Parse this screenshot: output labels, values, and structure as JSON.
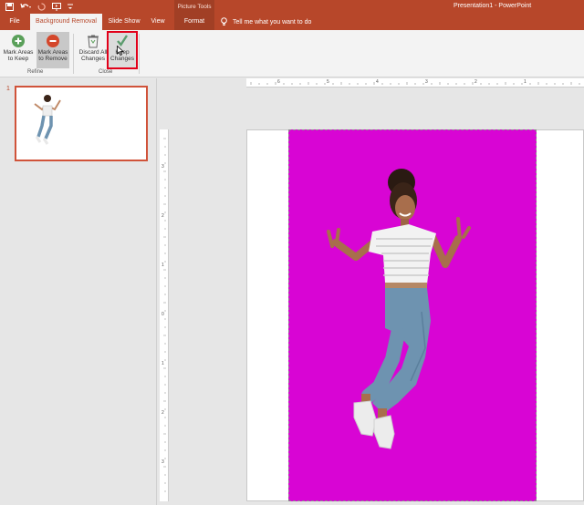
{
  "titlebar": {
    "picture_tools": "Picture Tools",
    "doc_title": "Presentation1  -  PowerPoint"
  },
  "tabs": {
    "file": "File",
    "background_removal": "Background Removal",
    "slide_show": "Slide Show",
    "view": "View",
    "format": "Format"
  },
  "tell_me": "Tell me what you want to do",
  "ribbon": {
    "mark_keep_l1": "Mark Areas",
    "mark_keep_l2": "to Keep",
    "mark_remove_l1": "Mark Areas",
    "mark_remove_l2": "to Remove",
    "discard_l1": "Discard All",
    "discard_l2": "Changes",
    "keep_l1": "Keep",
    "keep_l2": "Changes",
    "group_refine": "Refine",
    "group_close": "Close"
  },
  "slides": {
    "current_number": "1"
  },
  "ruler": {
    "h_labels": [
      "6",
      "5",
      "4",
      "3",
      "2",
      "1"
    ],
    "v_labels": [
      "3",
      "2",
      "1",
      "0",
      "1",
      "2",
      "3"
    ]
  },
  "colors": {
    "accent": "#b7472a",
    "removal_magenta": "#d805d4",
    "highlight": "#e2001a"
  }
}
